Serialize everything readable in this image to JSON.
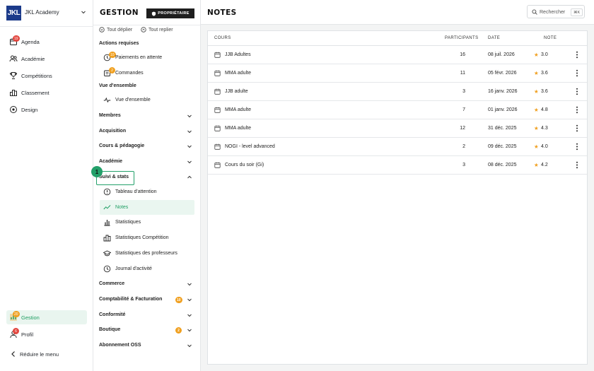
{
  "sidebar": {
    "logo_text": "JKL",
    "org_name": "JKL Academy",
    "items": [
      {
        "label": "Agenda",
        "icon": "calendar-icon",
        "badge": "19"
      },
      {
        "label": "Académie",
        "icon": "users-icon"
      },
      {
        "label": "Compétitions",
        "icon": "trophy-icon"
      },
      {
        "label": "Classement",
        "icon": "podium-icon"
      },
      {
        "label": "Design",
        "icon": "palette-icon"
      }
    ],
    "bottom_items": [
      {
        "label": "Gestion",
        "icon": "chart-icon",
        "badge": "20",
        "active": true
      },
      {
        "label": "Profil",
        "icon": "user-icon",
        "badge": "6"
      },
      {
        "label": "Réduire le menu",
        "icon": "chevron-left-icon"
      }
    ]
  },
  "panel": {
    "title": "GESTION",
    "owner_badge": "PROPRIÉTAIRE",
    "expand_all": "Tout déplier",
    "collapse_all": "Tout replier",
    "actions_title": "Actions requises",
    "actions": [
      {
        "label": "Paiements en attente",
        "badge": "10",
        "icon": "payment-icon"
      },
      {
        "label": "Commandes",
        "badge": "2",
        "icon": "orders-icon"
      }
    ],
    "overview_title": "Vue d'ensemble",
    "overview_item": "Vue d'ensemble",
    "groups_top": [
      "Membres",
      "Acquisition",
      "Cours & pédagogie",
      "Académie"
    ],
    "open_group": "Suivi & stats",
    "open_group_marker": "1",
    "stats_items": [
      {
        "label": "Tableau d'attention",
        "icon": "alert-icon"
      },
      {
        "label": "Notes",
        "icon": "trend-icon",
        "active": true
      },
      {
        "label": "Statistiques",
        "icon": "bar-chart-icon"
      },
      {
        "label": "Statistiques Compétition",
        "icon": "podium-icon"
      },
      {
        "label": "Statistiques des professeurs",
        "icon": "graduation-cap-icon"
      },
      {
        "label": "Journal d'activité",
        "icon": "clock-icon"
      }
    ],
    "groups_bottom": [
      {
        "label": "Commerce"
      },
      {
        "label": "Comptabilité & Facturation",
        "badge": "10"
      },
      {
        "label": "Conformité"
      },
      {
        "label": "Boutique",
        "badge": "2"
      },
      {
        "label": "Abonnement OSS"
      }
    ]
  },
  "main": {
    "title": "NOTES",
    "search_placeholder": "Rechercher",
    "search_shortcut": "⌘K",
    "columns": {
      "course": "COURS",
      "participants": "PARTICIPANTS",
      "date": "DATE",
      "note": "NOTE"
    },
    "rows": [
      {
        "course": "JJB Adultes",
        "participants": "16",
        "date": "08 juil. 2026",
        "note": "3.0"
      },
      {
        "course": "MMA adulte",
        "participants": "11",
        "date": "05 févr. 2026",
        "note": "3.6"
      },
      {
        "course": "JJB adulte",
        "participants": "3",
        "date": "16 janv. 2026",
        "note": "3.6"
      },
      {
        "course": "MMA adulte",
        "participants": "7",
        "date": "01 janv. 2026",
        "note": "4.8"
      },
      {
        "course": "MMA adulte",
        "participants": "12",
        "date": "31 déc. 2025",
        "note": "4.3"
      },
      {
        "course": "NOGI - level advanced",
        "participants": "2",
        "date": "09 déc. 2025",
        "note": "4.0"
      },
      {
        "course": "Cours du soir (Gi)",
        "participants": "3",
        "date": "08 déc. 2025",
        "note": "4.2"
      }
    ]
  },
  "colors": {
    "accent": "#1f9e63",
    "badge_red": "#e2473f",
    "badge_orange": "#f0a020",
    "logo_bg": "#1b3a8a"
  }
}
